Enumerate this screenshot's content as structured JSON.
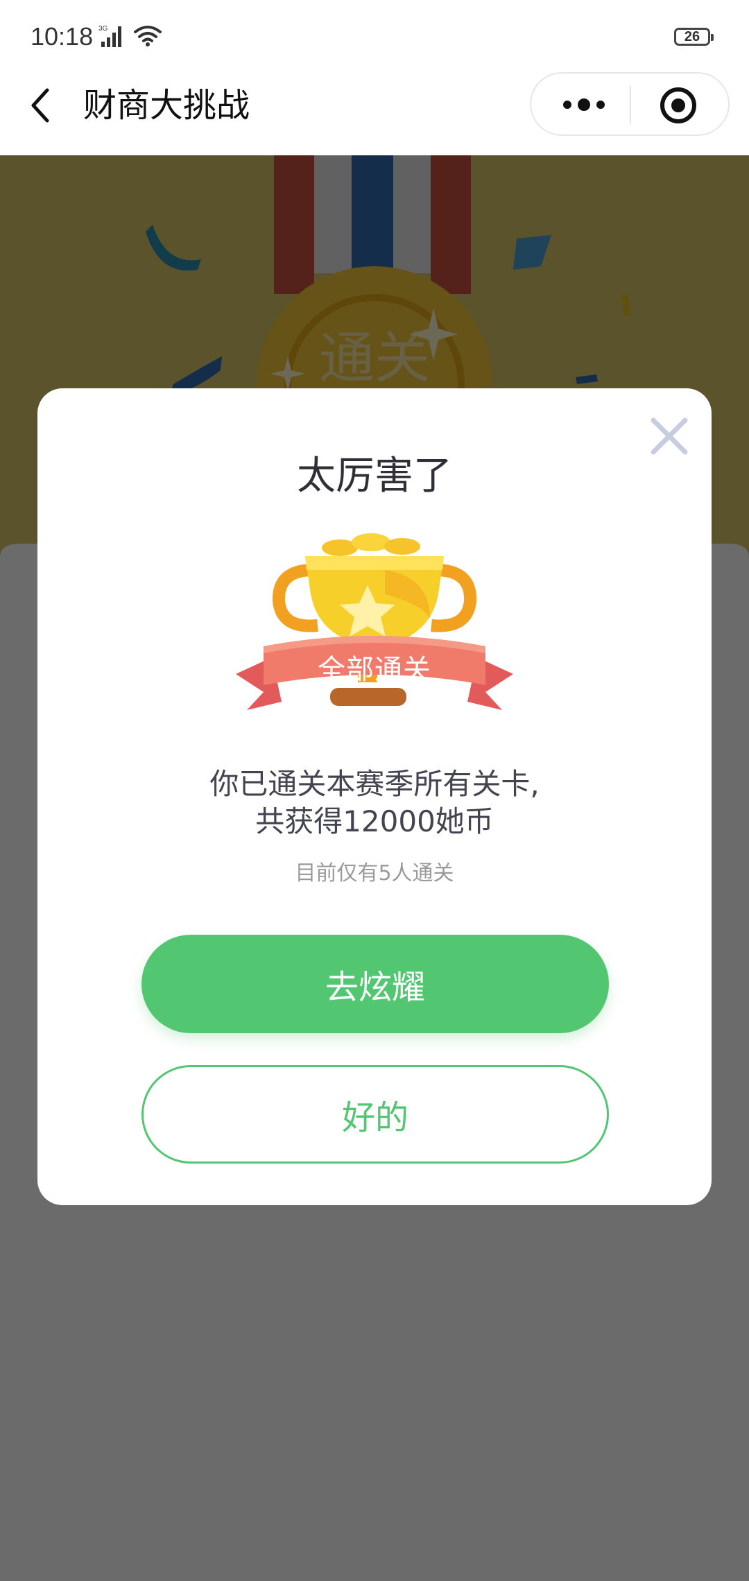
{
  "status_bar": {
    "time": "10:18",
    "network": "3G",
    "battery": "26"
  },
  "nav": {
    "title": "财商大挑战",
    "back_icon": "chevron-left-icon",
    "more_icon": "more-dots-icon",
    "close_icon": "target-circle-icon"
  },
  "background": {
    "medal_text": "通关",
    "colors": {
      "sky": "#d9c56a",
      "medal": "#f2c53a",
      "ribbon_blue": "#2f6db3",
      "ribbon_red": "#c9523e"
    }
  },
  "dialog": {
    "title": "太厉害了",
    "badge_label": "全部通关",
    "message_line1": "你已通关本赛季所有关卡,",
    "message_line2": "共获得12000她币",
    "subtext": "目前仅有5人通关",
    "primary_button": "去炫耀",
    "secondary_button": "好的",
    "close_icon": "close-x-icon"
  },
  "colors": {
    "accent_green": "#52c671",
    "overlay": "rgba(0,0,0,0.58)"
  }
}
